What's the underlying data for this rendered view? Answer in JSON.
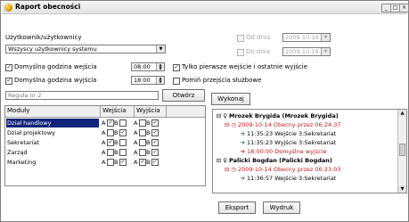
{
  "window": {
    "title": "Raport obecności",
    "min": "_",
    "max": "□",
    "close": "×"
  },
  "users": {
    "label": "Użytkownik/użytkownicy",
    "selected": "Wszyscy użytkownicy systemu"
  },
  "dates": {
    "from_label": "Od dnia",
    "from_value": "2009-10-16",
    "to_label": "Do dnia",
    "to_value": "2009-10-16"
  },
  "options": {
    "default_entry_label": "Domyślna godzina wejścia",
    "default_entry_value": "08:00",
    "default_exit_label": "Domyślna godzina wyjścia",
    "default_exit_value": "18:00",
    "first_last_only": "Tylko pierwsze wejście i ostatnie wyjście",
    "skip_business_exits": "Pomiń przejścia służbowe"
  },
  "rule": {
    "value": "Reguła nr 2",
    "open_button": "Otwórz",
    "run_button": "Wykonaj"
  },
  "grid": {
    "headers": [
      "Moduły",
      "Wejścia",
      "Wyjścia"
    ],
    "rows": [
      {
        "name": "Dział handlowy",
        "in_a": "✓",
        "in_b": "",
        "out_a": "",
        "out_b": "✓"
      },
      {
        "name": "Dział projektowy",
        "in_a": "",
        "in_b": "✓",
        "out_a": "",
        "out_b": "✓"
      },
      {
        "name": "Sekretariat",
        "in_a": "✓",
        "in_b": "",
        "out_a": "",
        "out_b": "✓"
      },
      {
        "name": "Zarząd",
        "in_a": "",
        "in_b": "",
        "out_a": "",
        "out_b": "✓"
      },
      {
        "name": "Marketing",
        "in_a": "",
        "in_b": "✓",
        "out_a": "✓",
        "out_b": "✓"
      }
    ],
    "a": "A",
    "b": "B"
  },
  "tree": {
    "lines": [
      {
        "text": "Mrozek Brygida (Mrozek Brygida)",
        "bold": true,
        "red": false
      },
      {
        "text": "2009-10-14  Obecny przez 06:24:37",
        "bold": false,
        "red": true
      },
      {
        "text": "11:35:23  Wejście 3:Sekretariat",
        "bold": false,
        "red": false
      },
      {
        "text": "11:35:23  Wyjście 3:Sekretariat",
        "bold": false,
        "red": false
      },
      {
        "text": "18:00:00  Domyślne wyjście",
        "bold": false,
        "red": true
      },
      {
        "text": "Palicki Bogdan (Palicki Bogdan)",
        "bold": true,
        "red": false
      },
      {
        "text": "2009-10-14  Obecny przez 06:23:03",
        "bold": false,
        "red": true
      },
      {
        "text": "11:36:57  Wejście 3:Sekretariat",
        "bold": false,
        "red": false
      }
    ]
  },
  "footer": {
    "export": "Eksport",
    "print": "Wydruk"
  },
  "colors": {
    "selection": "#10247a",
    "red": "#c41a1a",
    "green_arrow": "#1a7a1a"
  }
}
